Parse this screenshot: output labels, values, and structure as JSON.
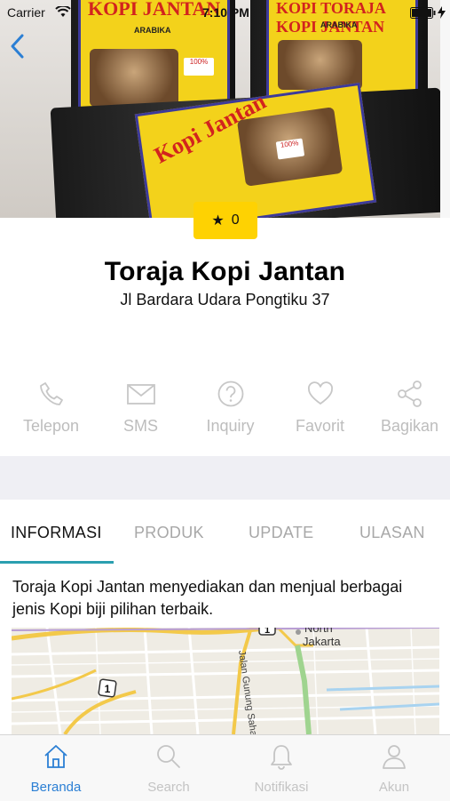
{
  "status_bar": {
    "carrier": "Carrier",
    "time": "7:10 PM"
  },
  "hero": {
    "product_label_1": "KOPI TORAJA KOPI JANTAN",
    "product_label_2": "ARABIKA"
  },
  "rating": {
    "star": "★",
    "value": "0"
  },
  "business": {
    "name": "Toraja Kopi Jantan",
    "address": "Jl Bardara Udara Pongtiku 37"
  },
  "actions": [
    {
      "label": "Telepon",
      "icon": "phone-icon"
    },
    {
      "label": "SMS",
      "icon": "envelope-icon"
    },
    {
      "label": "Inquiry",
      "icon": "question-icon"
    },
    {
      "label": "Favorit",
      "icon": "heart-icon"
    },
    {
      "label": "Bagikan",
      "icon": "share-icon"
    }
  ],
  "tabs": [
    {
      "label": "INFORMASI",
      "active": true
    },
    {
      "label": "PRODUK",
      "active": false
    },
    {
      "label": "UPDATE",
      "active": false
    },
    {
      "label": "ULASAN",
      "active": false
    }
  ],
  "description": "Toraja Kopi Jantan menyediakan dan menjual berbagai jenis Kopi biji pilihan terbaik.",
  "map": {
    "place_label_1": "North",
    "place_label_2": "Jakarta",
    "road_label": "Jalan Gunung Sahari",
    "route_number": "1",
    "route_number_2": "1"
  },
  "bottom_nav": [
    {
      "label": "Beranda",
      "icon": "home-icon",
      "active": true
    },
    {
      "label": "Search",
      "icon": "search-icon",
      "active": false
    },
    {
      "label": "Notifikasi",
      "icon": "bell-icon",
      "active": false
    },
    {
      "label": "Akun",
      "icon": "user-icon",
      "active": false
    }
  ],
  "colors": {
    "accent": "#2b7fd4",
    "rating_bg": "#fed202",
    "tab_indicator": "#2b9fb0"
  }
}
